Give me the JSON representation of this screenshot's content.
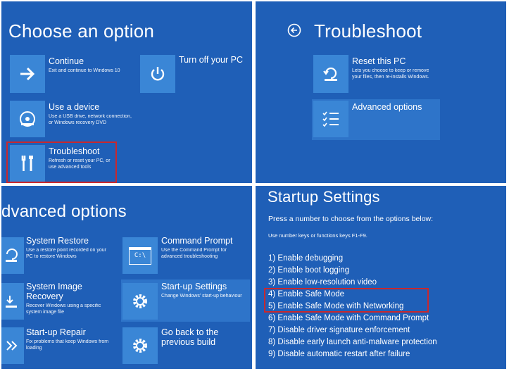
{
  "choose": {
    "title": "Choose an option",
    "continue": {
      "title": "Continue",
      "desc": "Exit and continue to Windows 10"
    },
    "turnoff": {
      "title": "Turn off your PC"
    },
    "device": {
      "title": "Use a device",
      "desc": "Use a USB drive, network connection, or Windows recovery DVD"
    },
    "troubleshoot": {
      "title": "Troubleshoot",
      "desc": "Refresh or reset your PC, or use advanced tools"
    }
  },
  "troubleshoot": {
    "title": "Troubleshoot",
    "reset": {
      "title": "Reset this PC",
      "desc": "Lets you choose to keep or remove your files, then re-installs Windows."
    },
    "advanced": {
      "title": "Advanced options"
    }
  },
  "advanced": {
    "title": "dvanced options",
    "system_restore": {
      "title": "System Restore",
      "desc": "Use a restore point recorded on your PC to restore Windows"
    },
    "command_prompt": {
      "title": "Command Prompt",
      "desc": "Use the Command Prompt for advanced troubleshooting",
      "glyph": "C:\\"
    },
    "image_recovery": {
      "title": "System Image Recovery",
      "desc": "Recover Windows using a specific system image file"
    },
    "startup_settings": {
      "title": "Start-up Settings",
      "desc": "Change Windows' start-up behaviour"
    },
    "startup_repair": {
      "title": "Start-up Repair",
      "desc": "Fix problems that keep Windows from loading"
    },
    "previous_build": {
      "title": "Go back to the previous build"
    }
  },
  "startup": {
    "title": "Startup Settings",
    "prompt": "Press a number to choose from the options below:",
    "hint": "Use number keys or functions keys F1-F9.",
    "options": [
      "1) Enable debugging",
      "2) Enable boot logging",
      "3) Enable low-resolution video",
      "4) Enable Safe Mode",
      "5) Enable Safe Mode with Networking",
      "6) Enable Safe Mode with Command Prompt",
      "7) Disable driver signature enforcement",
      "8) Disable early launch anti-malware protection",
      "9) Disable automatic restart after failure"
    ]
  },
  "colors": {
    "background": "#1f5fb7",
    "tile": "#3a86d6",
    "highlight": "#2e74c9",
    "callout": "#c8282e"
  }
}
